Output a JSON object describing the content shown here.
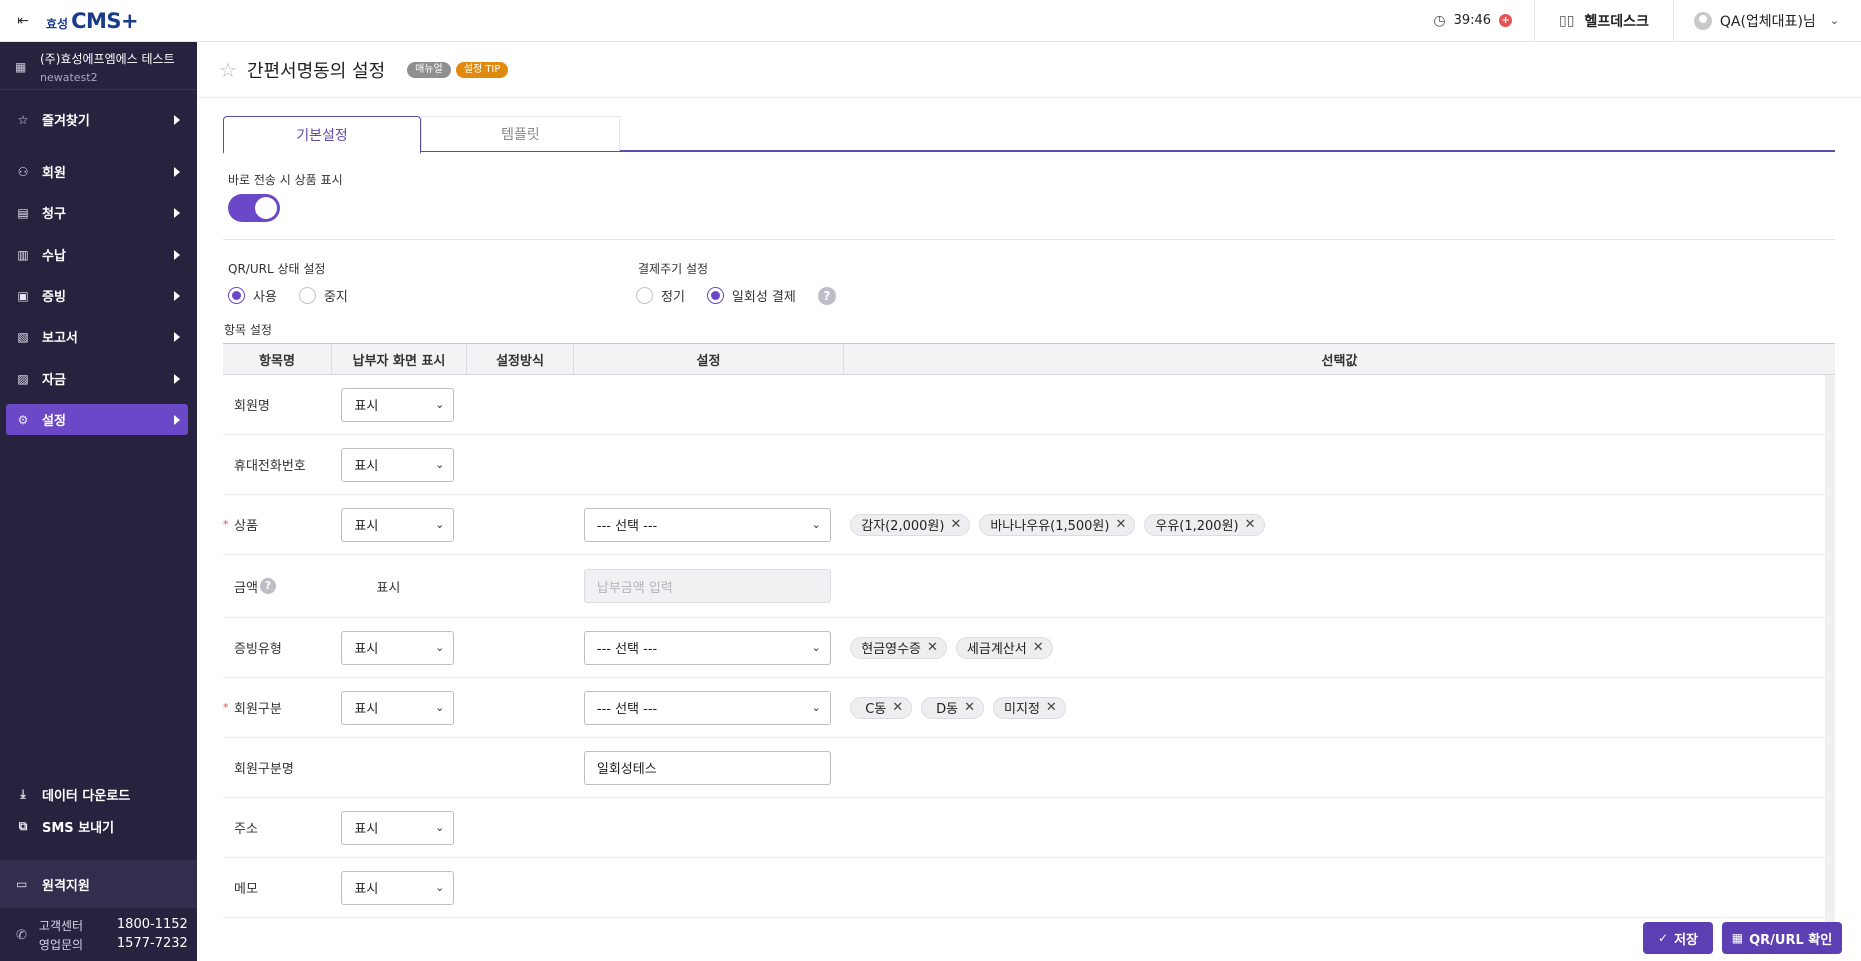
{
  "topbar": {
    "logo_prefix": "효성",
    "logo_main": "CMS+",
    "session_time": "39:46",
    "helpdesk_label": "헬프데스크",
    "user_label": "QA(업체대표)님"
  },
  "sidebar": {
    "company_name": "(주)효성에프엠에스 테스트",
    "company_id": "newatest2",
    "items": [
      {
        "label": "즐겨찾기",
        "icon": "star-icon"
      },
      {
        "label": "회원",
        "icon": "person-icon"
      },
      {
        "label": "청구",
        "icon": "bill-icon"
      },
      {
        "label": "수납",
        "icon": "calculator-icon"
      },
      {
        "label": "증빙",
        "icon": "receipt-icon"
      },
      {
        "label": "보고서",
        "icon": "report-icon"
      },
      {
        "label": "자금",
        "icon": "wallet-icon"
      },
      {
        "label": "설정",
        "icon": "gear-icon"
      }
    ],
    "active_item": "설정",
    "download_label": "데이터 다운로드",
    "sms_label": "SMS 보내기",
    "remote_label": "원격지원",
    "contact": {
      "center_label": "고객센터",
      "center_phone": "1800-1152",
      "sales_label": "영업문의",
      "sales_phone": "1577-7232"
    }
  },
  "page": {
    "title": "간편서명동의 설정",
    "manual_badge": "매뉴얼",
    "tip_badge": "설정 TIP"
  },
  "tabs": [
    {
      "label": "기본설정",
      "active": true
    },
    {
      "label": "템플릿",
      "active": false
    }
  ],
  "settings": {
    "product_display_label": "바로 전송 시 상품 표시",
    "product_display_on": true,
    "qr_status_label": "QR/URL 상태 설정",
    "qr_options": [
      "사용",
      "중지"
    ],
    "qr_selected": "사용",
    "cycle_label": "결제주기 설정",
    "cycle_options": [
      "정기",
      "일회성 결제"
    ],
    "cycle_selected": "일회성 결제",
    "items_label": "항목 설정"
  },
  "table": {
    "headers": [
      "항목명",
      "납부자 화면 표시",
      "설정방식",
      "설정",
      "선택값"
    ],
    "rows": [
      {
        "name": "회원명",
        "required": false,
        "display": "표시"
      },
      {
        "name": "휴대전화번호",
        "required": false,
        "display": "표시"
      },
      {
        "name": "상품",
        "required": true,
        "display": "표시",
        "setting": "--- 선택 ---",
        "values": [
          "감자(2,000원)",
          "바나나우유(1,500원)",
          "우유(1,200원)"
        ]
      },
      {
        "name": "금액",
        "required": false,
        "display_static": "표시",
        "input_placeholder": "납부금액 입력"
      },
      {
        "name": "증빙유형",
        "required": false,
        "display": "표시",
        "setting": "--- 선택 ---",
        "values": [
          "현금영수증",
          "세금계산서"
        ]
      },
      {
        "name": "회원구분",
        "required": true,
        "display": "표시",
        "setting": "--- 선택 ---",
        "values": [
          "C동",
          "D동",
          "미지정"
        ]
      },
      {
        "name": "회원구분명",
        "required": false,
        "input_value": "일회성테스"
      },
      {
        "name": "주소",
        "required": false,
        "display": "표시"
      },
      {
        "name": "메모",
        "required": false,
        "display": "표시"
      }
    ]
  },
  "buttons": {
    "save": "저장",
    "qr_check": "QR/URL 확인"
  },
  "colors": {
    "sidebar_bg": "#27233f",
    "accent": "#6b48c8",
    "tip_badge": "#e08a0f",
    "required": "#e14b4b"
  }
}
